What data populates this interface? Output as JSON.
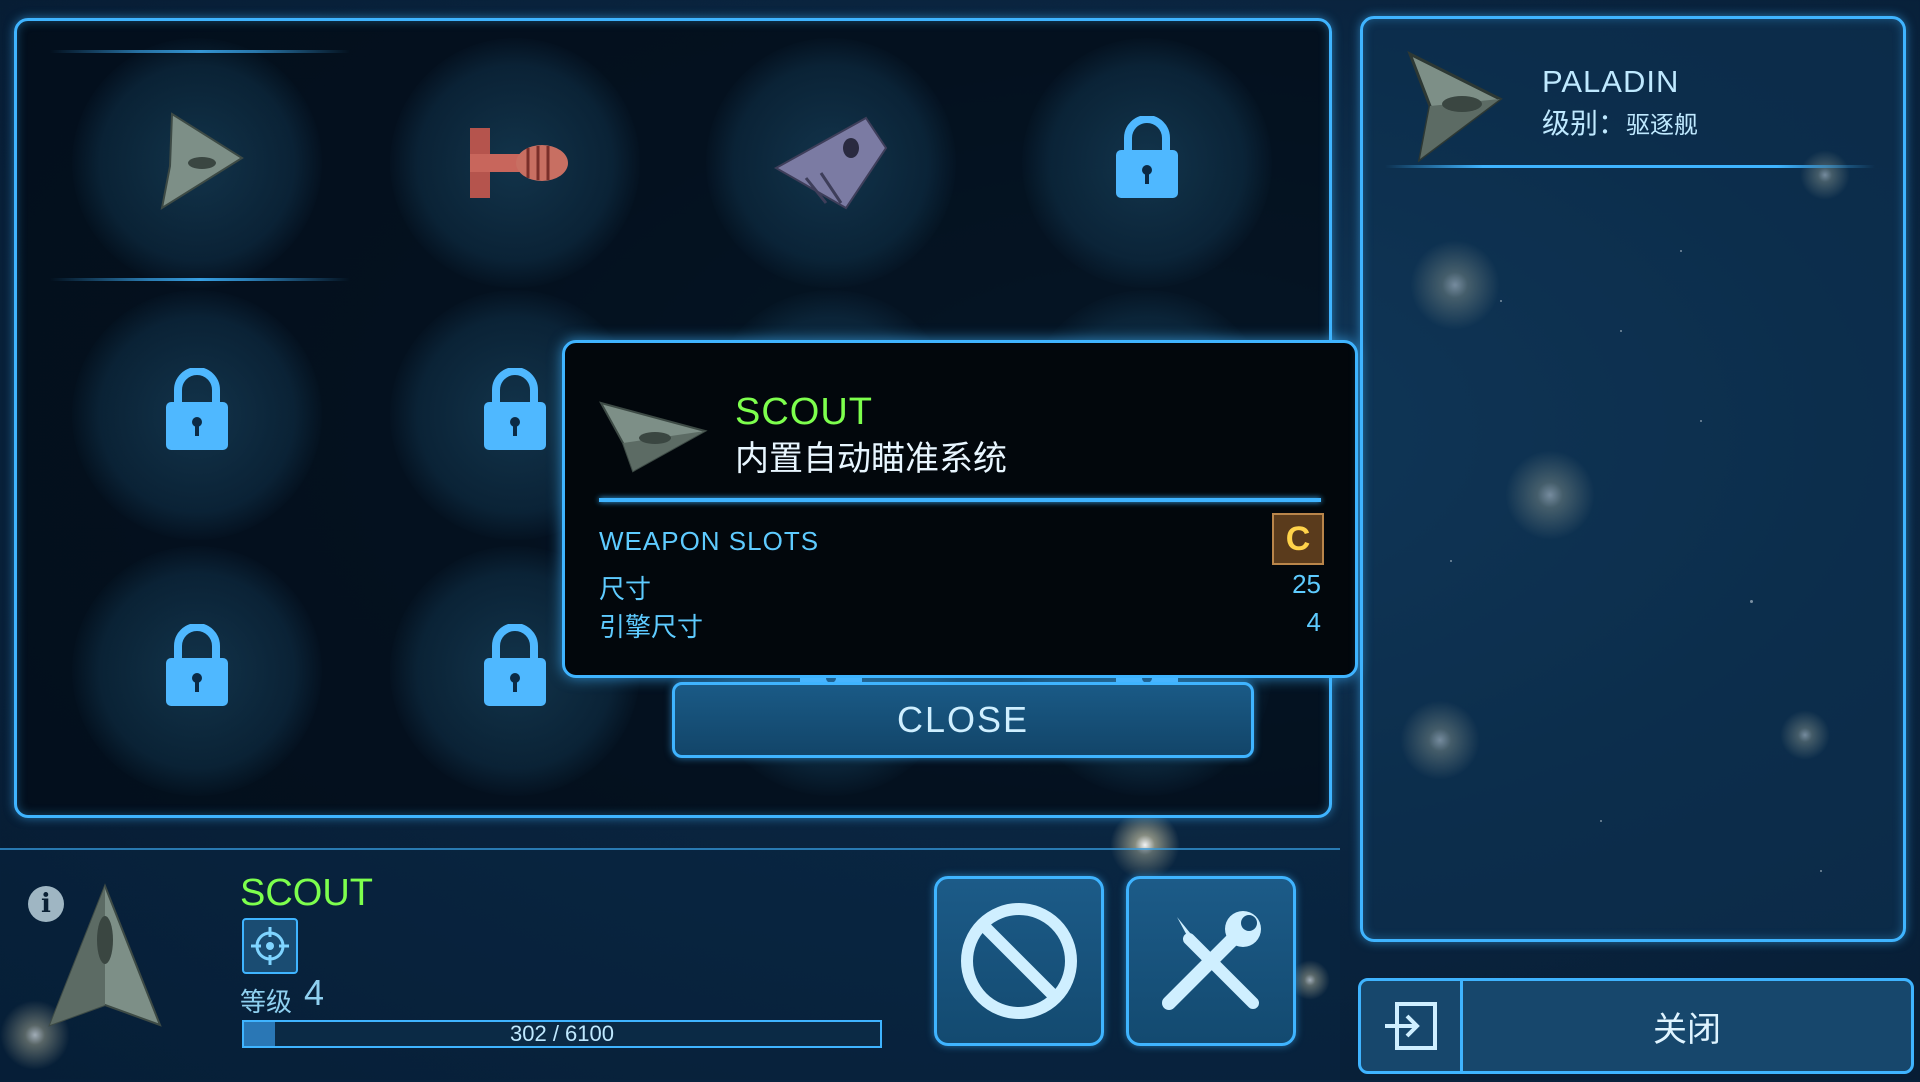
{
  "hangar": {
    "slots": [
      {
        "type": "ship",
        "ship": "scout-ship-icon",
        "selected": true
      },
      {
        "type": "ship",
        "ship": "cargo-ship-icon",
        "selected": false
      },
      {
        "type": "ship",
        "ship": "fighter-ship-icon",
        "selected": false
      },
      {
        "type": "locked"
      },
      {
        "type": "locked"
      },
      {
        "type": "locked"
      },
      {
        "type": "locked"
      },
      {
        "type": "locked"
      },
      {
        "type": "locked"
      },
      {
        "type": "locked"
      },
      {
        "type": "locked"
      },
      {
        "type": "locked"
      }
    ]
  },
  "popup": {
    "name": "SCOUT",
    "description": "内置自动瞄准系统",
    "weapon_slots_label": "WEAPON SLOTS",
    "weapon_class": "C",
    "stats": [
      {
        "label": "尺寸",
        "value": "25"
      },
      {
        "label": "引擎尺寸",
        "value": "4"
      }
    ],
    "close_label": "CLOSE"
  },
  "detail": {
    "name": "PALADIN",
    "class_label": "级别：",
    "class_value": "驱逐舰",
    "close_label": "关闭"
  },
  "current": {
    "name": "SCOUT",
    "level_label": "等级",
    "level": "4",
    "xp_text": "302 / 6100",
    "xp_fraction": 0.0495
  },
  "colors": {
    "accent": "#3fb4ff",
    "name_green": "#7dff4d",
    "class_badge": "#ffd34a"
  }
}
